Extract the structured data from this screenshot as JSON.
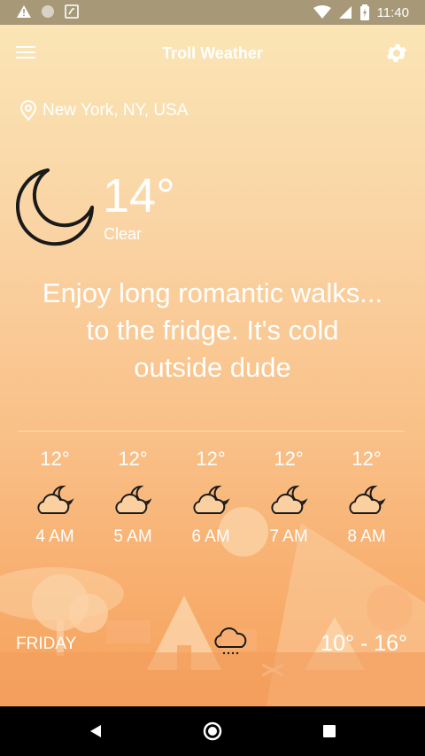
{
  "status_bar": {
    "time": "11:40",
    "left_icons": [
      "warning-icon",
      "circle-icon",
      "sd-card-icon"
    ],
    "right_icons": [
      "wifi-icon",
      "signal-icon",
      "battery-icon"
    ]
  },
  "app_bar": {
    "title": "Troll Weather",
    "menu_icon": "hamburger-menu-icon",
    "settings_icon": "gear-icon"
  },
  "location": {
    "icon": "location-pin-icon",
    "name": "New York, NY, USA"
  },
  "current": {
    "icon": "moon-icon",
    "temperature": "14°",
    "condition": "Clear",
    "message": [
      "Enjoy long romantic walks...",
      "to the fridge. It's cold",
      "outside dude"
    ]
  },
  "hourly": [
    {
      "temp": "12°",
      "time": "4 AM",
      "icon": "partly-cloudy-night-icon"
    },
    {
      "temp": "12°",
      "time": "5 AM",
      "icon": "partly-cloudy-night-icon"
    },
    {
      "temp": "12°",
      "time": "6 AM",
      "icon": "partly-cloudy-night-icon"
    },
    {
      "temp": "12°",
      "time": "7 AM",
      "icon": "partly-cloudy-night-icon"
    },
    {
      "temp": "12°",
      "time": "8 AM",
      "icon": "partly-cloudy-night-icon"
    }
  ],
  "daily": {
    "day": "FRIDAY",
    "icon": "drizzle-cloud-icon",
    "range": "10° - 16°"
  },
  "nav_bar": {
    "icons": [
      "back-icon",
      "home-icon",
      "recents-icon"
    ]
  },
  "colors": {
    "gradient_top": "#fbe7b7",
    "gradient_bottom": "#f39d5d",
    "status_bar": "#a79878",
    "text": "#ffffff",
    "icon_stroke": "#1a1a1a"
  }
}
